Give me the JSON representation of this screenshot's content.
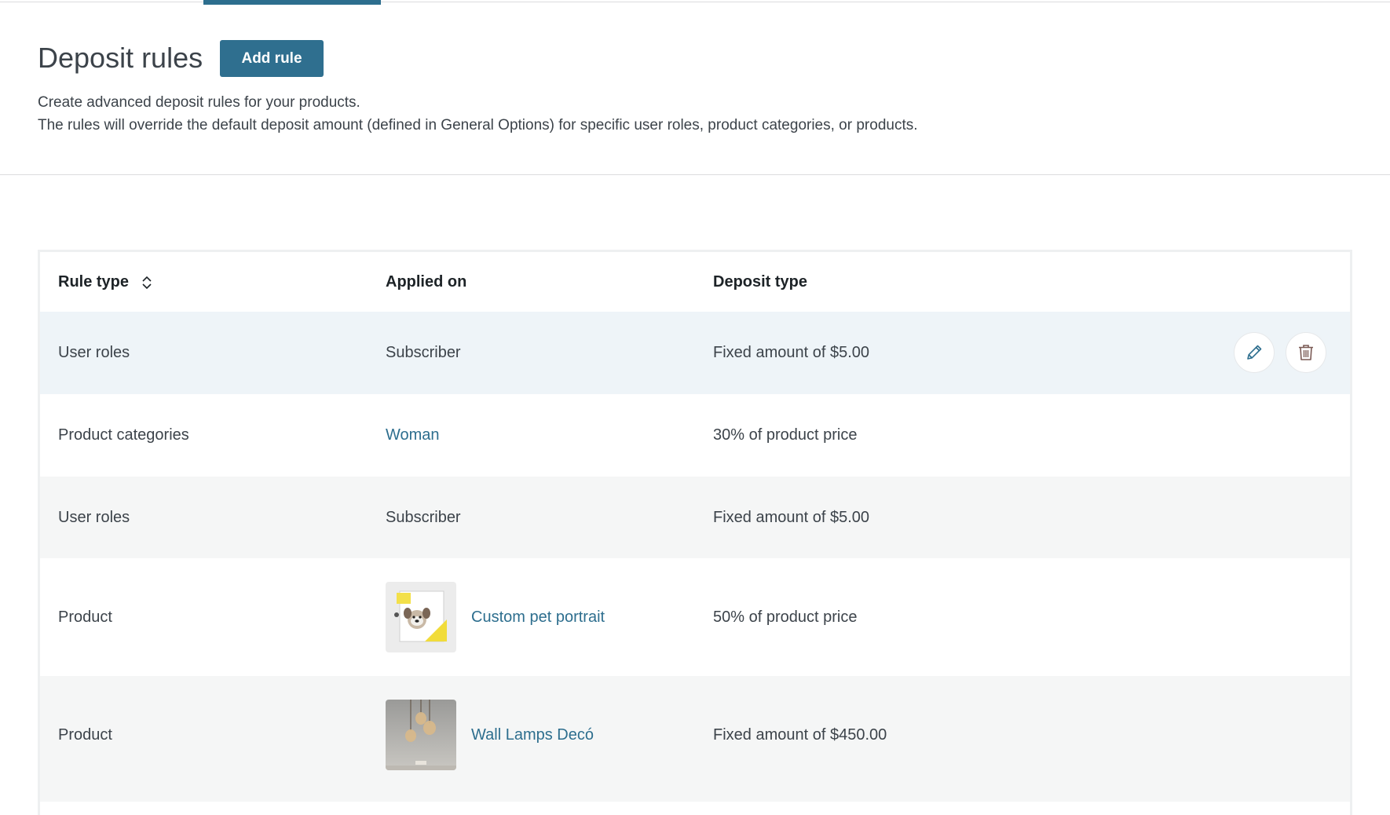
{
  "header": {
    "title": "Deposit rules",
    "add_rule_label": "Add rule",
    "description_line1": "Create advanced deposit rules for your products.",
    "description_line2": "The rules will override the default deposit amount (defined in General Options) for specific user roles, product categories, or products."
  },
  "table": {
    "columns": {
      "rule_type": "Rule type",
      "applied_on": "Applied on",
      "deposit_type": "Deposit type"
    },
    "rows": [
      {
        "rule_type": "User roles",
        "applied_on": "Subscriber",
        "deposit_type": "Fixed amount of $5.00"
      },
      {
        "rule_type": "Product categories",
        "applied_on": "Woman",
        "deposit_type": "30% of product price"
      },
      {
        "rule_type": "User roles",
        "applied_on": "Subscriber",
        "deposit_type": "Fixed amount of $5.00"
      },
      {
        "rule_type": "Product",
        "applied_on": "Custom pet portrait",
        "deposit_type": "50% of product price"
      },
      {
        "rule_type": "Product",
        "applied_on": "Wall Lamps Decó",
        "deposit_type": "Fixed amount of $450.00"
      }
    ]
  },
  "icons": {
    "sort": "sort-icon",
    "edit": "pencil-icon",
    "delete": "trash-icon"
  },
  "colors": {
    "accent": "#2f6f8f",
    "link": "#2d6e8e",
    "hover_row": "#eef4f8",
    "alt_row": "#f5f6f6"
  }
}
